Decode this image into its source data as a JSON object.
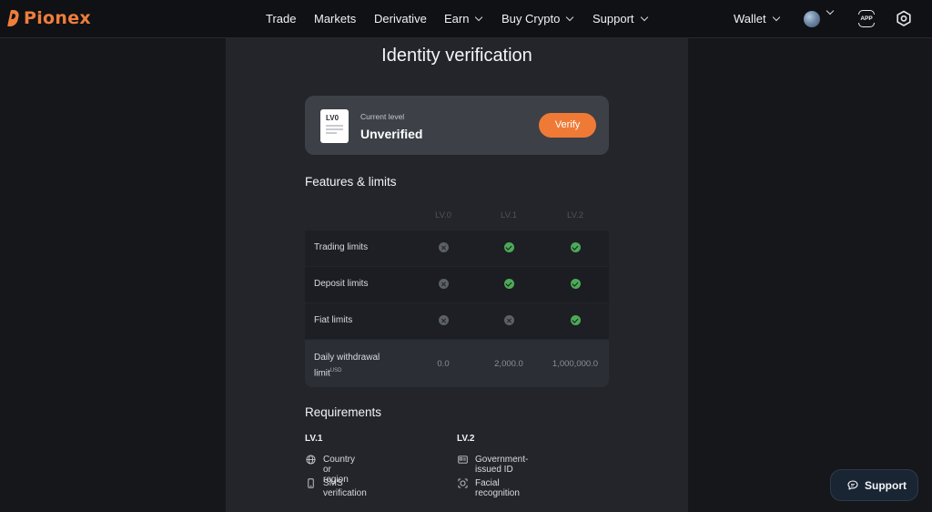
{
  "brand": {
    "name": "Pionex",
    "accent": "#ef7d3c"
  },
  "nav": {
    "trade": "Trade",
    "markets": "Markets",
    "derivative": "Derivative",
    "earn": "Earn",
    "buy_crypto": "Buy Crypto",
    "support": "Support",
    "wallet": "Wallet",
    "app_badge": "APP",
    "icons": [
      "chevron-down-icon",
      "globe-icon",
      "app-icon",
      "settings-icon"
    ]
  },
  "page": {
    "title": "Identity verification"
  },
  "level_card": {
    "doc_label": "LV0",
    "current_label": "Current level",
    "current_value": "Unverified",
    "verify_label": "Verify"
  },
  "features": {
    "title": "Features & limits",
    "columns": [
      "LV.0",
      "LV.1",
      "LV.2"
    ],
    "rows": [
      {
        "label": "Trading limits",
        "status": [
          "no",
          "yes",
          "yes"
        ]
      },
      {
        "label": "Deposit limits",
        "status": [
          "no",
          "yes",
          "yes"
        ]
      },
      {
        "label": "Fiat limits",
        "status": [
          "no",
          "no",
          "yes"
        ]
      }
    ],
    "withdrawal": {
      "label": "Daily withdrawal limit",
      "unit": "USD",
      "values": [
        "0.0",
        "2,000.0",
        "1,000,000.0"
      ]
    }
  },
  "requirements": {
    "title": "Requirements",
    "lv1": {
      "heading": "LV.1",
      "items": [
        "Country or region",
        "SMS verification"
      ]
    },
    "lv2": {
      "heading": "LV.2",
      "items": [
        "Government-issued ID",
        "Facial recognition"
      ]
    }
  },
  "support_button": {
    "label": "Support"
  }
}
